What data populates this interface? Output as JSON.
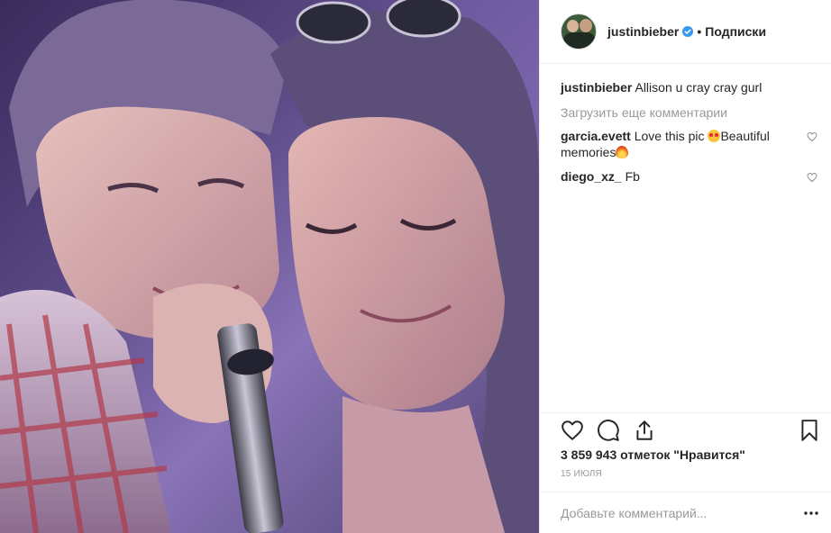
{
  "post": {
    "author": "justinbieber",
    "follow_label": "Подписки",
    "separator": "•",
    "caption": {
      "username": "justinbieber",
      "text": "Allison u cray cray gurl"
    },
    "load_more_label": "Загрузить еще комментарии",
    "comments": [
      {
        "username": "garcia.evett",
        "text_before": "Love this pic ",
        "emoji1": "heart-eyes-emoji",
        "text_after": "Beautiful memories",
        "emoji2": "fire-emoji"
      },
      {
        "username": "diego_xz_",
        "text": "Fb"
      }
    ],
    "likes_text": "3 859 943 отметок \"Нравится\"",
    "date": "15 ИЮЛЯ",
    "add_comment_placeholder": "Добавьте комментарий...",
    "more_label": "..."
  },
  "colors": {
    "text": "#262626",
    "muted": "#999999",
    "border": "#efefef",
    "verified": "#3897f0"
  },
  "icons": [
    "verified-icon",
    "heart-icon",
    "comment-icon",
    "share-icon",
    "bookmark-icon",
    "more-icon"
  ]
}
